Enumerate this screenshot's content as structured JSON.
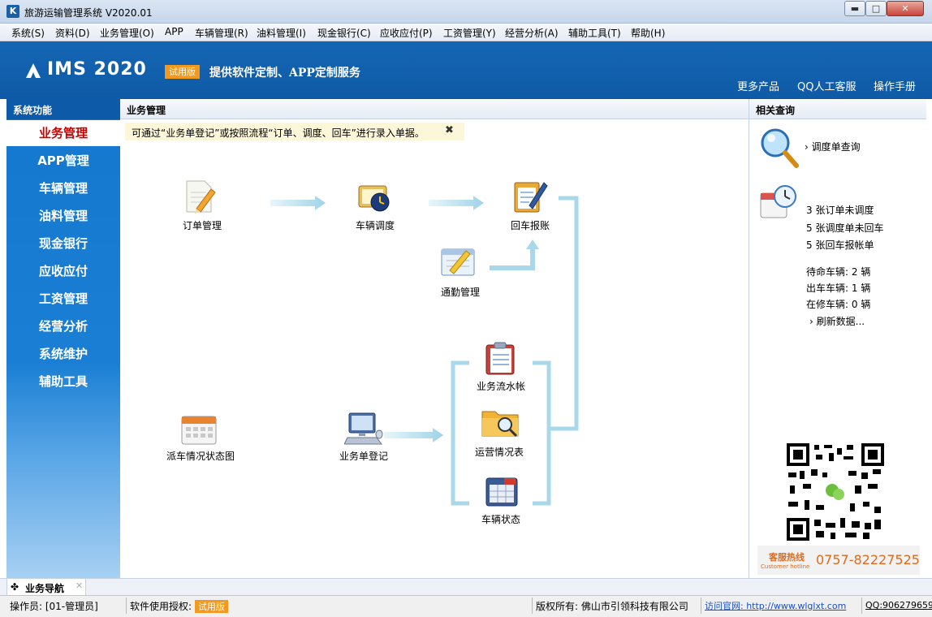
{
  "window": {
    "title": "旅游运输管理系统 V2020.01",
    "min_glyph": "▬",
    "max_glyph": "□",
    "close_glyph": "✕"
  },
  "menu": [
    "系统(S)",
    "资料(D)",
    "业务管理(O)",
    "APP",
    "车辆管理(R)",
    "油料管理(I)",
    "现金银行(C)",
    "应收应付(P)",
    "工资管理(Y)",
    "经营分析(A)",
    "辅助工具(T)",
    "帮助(H)"
  ],
  "banner": {
    "logo": "IMS 2020",
    "trial_badge": "试用版",
    "slogan": "提供软件定制、APP定制服务",
    "links": [
      "更多产品",
      "QQ人工客服",
      "操作手册"
    ]
  },
  "sidebar": {
    "header": "系统功能",
    "items": [
      "业务管理",
      "APP管理",
      "车辆管理",
      "油料管理",
      "现金银行",
      "应收应付",
      "工资管理",
      "经营分析",
      "系统维护",
      "辅助工具"
    ],
    "active_index": 0
  },
  "main": {
    "header": "业务管理",
    "notice": "可通过“业务单登记”或按照流程“订单、调度、回车”进行录入单据。",
    "nodes": {
      "order": "订单管理",
      "dispatch": "车辆调度",
      "return": "回车报账",
      "commute": "通勤管理",
      "journal": "业务流水帐",
      "ops_report": "运营情况表",
      "vehicle_status": "车辆状态",
      "dispatch_chart": "派车情况状态图",
      "register": "业务单登记"
    }
  },
  "right": {
    "header": "相关查询",
    "query_link": "调度单查询",
    "counts": [
      {
        "num": "3",
        "text": "张订单未调度"
      },
      {
        "num": "5",
        "text": "张调度单未回车"
      },
      {
        "num": "5",
        "text": "张回车报帐单"
      }
    ],
    "vehicles": [
      {
        "label": "待命车辆:",
        "num": "2",
        "unit": "辆"
      },
      {
        "label": "出车车辆:",
        "num": "1",
        "unit": "辆"
      },
      {
        "label": "在修车辆:",
        "num": "0",
        "unit": "辆"
      }
    ],
    "refresh": "刷新数据...",
    "hotline_cn": "客服热线",
    "hotline_en": "Customer hotline",
    "hotline_num": "0757-82227525"
  },
  "bottom_tab": {
    "label": "业务导航",
    "close": "✕"
  },
  "status": {
    "operator": "操作员: [01-管理员]",
    "license_label": "软件使用授权:",
    "license_value": "试用版",
    "copyright": "版权所有: 佛山市引领科技有限公司",
    "site_label": "访问官网: http://www.wlglxt.com",
    "qq": "QQ:906279659"
  },
  "colors": {
    "brand_blue": "#1466b4",
    "accent_orange": "#f39a1e",
    "flow_line": "#a9d8ea",
    "active_text": "#cc0000"
  }
}
